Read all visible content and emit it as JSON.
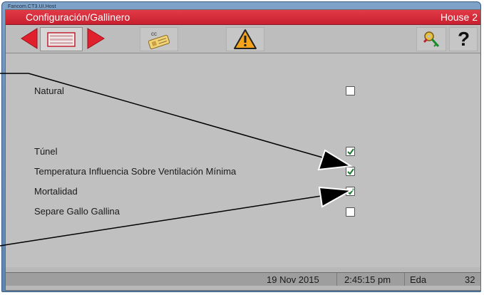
{
  "window": {
    "title": "Fancom.CT3.UI.Host"
  },
  "header": {
    "title": "Configuración/Gallinero",
    "house": "House 2"
  },
  "toolbar": {
    "buttons": [
      {
        "name": "previous-button",
        "icon": "left-arrow-icon"
      },
      {
        "name": "list-button",
        "icon": "list-icon"
      },
      {
        "name": "next-button",
        "icon": "right-arrow-icon"
      },
      {
        "name": "copy-config-button",
        "icon": "keycard-icon",
        "label": "cc"
      },
      {
        "name": "alarm-button",
        "icon": "warning-icon"
      },
      {
        "name": "key-button",
        "icon": "key-icon"
      },
      {
        "name": "help-button",
        "icon": "question-icon",
        "label": "?"
      }
    ]
  },
  "settings": [
    {
      "label": "Natural",
      "checked": false
    },
    {
      "label": "Túnel",
      "checked": true
    },
    {
      "label": "Temperatura Influencia Sobre Ventilación Mínima",
      "checked": true
    },
    {
      "label": "Mortalidad",
      "checked": true
    },
    {
      "label": "Separe Gallo Gallina",
      "checked": false
    }
  ],
  "status": {
    "date": "19 Nov 2015",
    "time": "2:45:15 pm",
    "age_label": "Eda",
    "age_value": "32"
  },
  "colors": {
    "header": "#d42b39",
    "arrow_red": "#e0202c",
    "warning_orange": "#f3a31c"
  }
}
